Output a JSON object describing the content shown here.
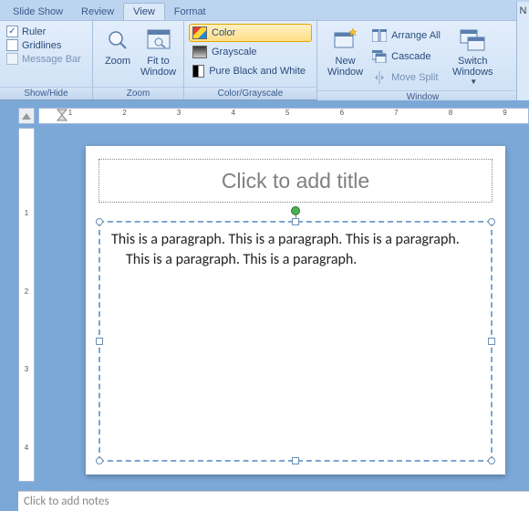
{
  "tabs": {
    "slideShow": "Slide Show",
    "review": "Review",
    "view": "View",
    "format": "Format"
  },
  "activeTab": "view",
  "groups": {
    "showHide": {
      "label": "Show/Hide",
      "ruler": "Ruler",
      "gridlines": "Gridlines",
      "messageBar": "Message Bar",
      "rulerChecked": true,
      "gridlinesChecked": false,
      "messageBarChecked": false
    },
    "zoom": {
      "label": "Zoom",
      "zoomBtn": "Zoom",
      "fitBtn": "Fit to\nWindow"
    },
    "colorGrayscale": {
      "label": "Color/Grayscale",
      "color": "Color",
      "grayscale": "Grayscale",
      "pureBW": "Pure Black and White",
      "selected": "color"
    },
    "window": {
      "label": "Window",
      "newWindow": "New\nWindow",
      "arrangeAll": "Arrange All",
      "cascade": "Cascade",
      "moveSplit": "Move Split",
      "switch": "Switch\nWindows"
    }
  },
  "slide": {
    "titlePlaceholder": "Click to add title",
    "bodyText": "This is a paragraph. This is a paragraph. This is a paragraph. This is a paragraph. This is a paragraph."
  },
  "notesPlaceholder": "Click to add notes",
  "hruler": [
    "",
    "1",
    "",
    "2",
    "",
    "3",
    "",
    "4",
    "",
    "5",
    "",
    "6",
    "",
    "7",
    "",
    "8",
    "",
    "9"
  ],
  "vruler": [
    "",
    "",
    "1",
    "",
    "2",
    "",
    "3",
    "",
    "4"
  ],
  "rightNav": "N"
}
